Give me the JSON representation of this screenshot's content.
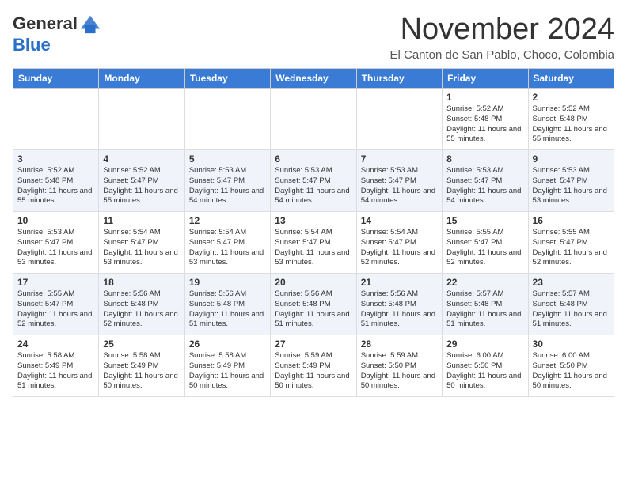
{
  "header": {
    "logo_general": "General",
    "logo_blue": "Blue",
    "month_title": "November 2024",
    "location": "El Canton de San Pablo, Choco, Colombia"
  },
  "calendar": {
    "weekdays": [
      "Sunday",
      "Monday",
      "Tuesday",
      "Wednesday",
      "Thursday",
      "Friday",
      "Saturday"
    ],
    "weeks": [
      [
        {
          "day": "",
          "info": ""
        },
        {
          "day": "",
          "info": ""
        },
        {
          "day": "",
          "info": ""
        },
        {
          "day": "",
          "info": ""
        },
        {
          "day": "",
          "info": ""
        },
        {
          "day": "1",
          "info": "Sunrise: 5:52 AM\nSunset: 5:48 PM\nDaylight: 11 hours and 55 minutes."
        },
        {
          "day": "2",
          "info": "Sunrise: 5:52 AM\nSunset: 5:48 PM\nDaylight: 11 hours and 55 minutes."
        }
      ],
      [
        {
          "day": "3",
          "info": "Sunrise: 5:52 AM\nSunset: 5:48 PM\nDaylight: 11 hours and 55 minutes."
        },
        {
          "day": "4",
          "info": "Sunrise: 5:52 AM\nSunset: 5:47 PM\nDaylight: 11 hours and 55 minutes."
        },
        {
          "day": "5",
          "info": "Sunrise: 5:53 AM\nSunset: 5:47 PM\nDaylight: 11 hours and 54 minutes."
        },
        {
          "day": "6",
          "info": "Sunrise: 5:53 AM\nSunset: 5:47 PM\nDaylight: 11 hours and 54 minutes."
        },
        {
          "day": "7",
          "info": "Sunrise: 5:53 AM\nSunset: 5:47 PM\nDaylight: 11 hours and 54 minutes."
        },
        {
          "day": "8",
          "info": "Sunrise: 5:53 AM\nSunset: 5:47 PM\nDaylight: 11 hours and 54 minutes."
        },
        {
          "day": "9",
          "info": "Sunrise: 5:53 AM\nSunset: 5:47 PM\nDaylight: 11 hours and 53 minutes."
        }
      ],
      [
        {
          "day": "10",
          "info": "Sunrise: 5:53 AM\nSunset: 5:47 PM\nDaylight: 11 hours and 53 minutes."
        },
        {
          "day": "11",
          "info": "Sunrise: 5:54 AM\nSunset: 5:47 PM\nDaylight: 11 hours and 53 minutes."
        },
        {
          "day": "12",
          "info": "Sunrise: 5:54 AM\nSunset: 5:47 PM\nDaylight: 11 hours and 53 minutes."
        },
        {
          "day": "13",
          "info": "Sunrise: 5:54 AM\nSunset: 5:47 PM\nDaylight: 11 hours and 53 minutes."
        },
        {
          "day": "14",
          "info": "Sunrise: 5:54 AM\nSunset: 5:47 PM\nDaylight: 11 hours and 52 minutes."
        },
        {
          "day": "15",
          "info": "Sunrise: 5:55 AM\nSunset: 5:47 PM\nDaylight: 11 hours and 52 minutes."
        },
        {
          "day": "16",
          "info": "Sunrise: 5:55 AM\nSunset: 5:47 PM\nDaylight: 11 hours and 52 minutes."
        }
      ],
      [
        {
          "day": "17",
          "info": "Sunrise: 5:55 AM\nSunset: 5:47 PM\nDaylight: 11 hours and 52 minutes."
        },
        {
          "day": "18",
          "info": "Sunrise: 5:56 AM\nSunset: 5:48 PM\nDaylight: 11 hours and 52 minutes."
        },
        {
          "day": "19",
          "info": "Sunrise: 5:56 AM\nSunset: 5:48 PM\nDaylight: 11 hours and 51 minutes."
        },
        {
          "day": "20",
          "info": "Sunrise: 5:56 AM\nSunset: 5:48 PM\nDaylight: 11 hours and 51 minutes."
        },
        {
          "day": "21",
          "info": "Sunrise: 5:56 AM\nSunset: 5:48 PM\nDaylight: 11 hours and 51 minutes."
        },
        {
          "day": "22",
          "info": "Sunrise: 5:57 AM\nSunset: 5:48 PM\nDaylight: 11 hours and 51 minutes."
        },
        {
          "day": "23",
          "info": "Sunrise: 5:57 AM\nSunset: 5:48 PM\nDaylight: 11 hours and 51 minutes."
        }
      ],
      [
        {
          "day": "24",
          "info": "Sunrise: 5:58 AM\nSunset: 5:49 PM\nDaylight: 11 hours and 51 minutes."
        },
        {
          "day": "25",
          "info": "Sunrise: 5:58 AM\nSunset: 5:49 PM\nDaylight: 11 hours and 50 minutes."
        },
        {
          "day": "26",
          "info": "Sunrise: 5:58 AM\nSunset: 5:49 PM\nDaylight: 11 hours and 50 minutes."
        },
        {
          "day": "27",
          "info": "Sunrise: 5:59 AM\nSunset: 5:49 PM\nDaylight: 11 hours and 50 minutes."
        },
        {
          "day": "28",
          "info": "Sunrise: 5:59 AM\nSunset: 5:50 PM\nDaylight: 11 hours and 50 minutes."
        },
        {
          "day": "29",
          "info": "Sunrise: 6:00 AM\nSunset: 5:50 PM\nDaylight: 11 hours and 50 minutes."
        },
        {
          "day": "30",
          "info": "Sunrise: 6:00 AM\nSunset: 5:50 PM\nDaylight: 11 hours and 50 minutes."
        }
      ]
    ]
  }
}
